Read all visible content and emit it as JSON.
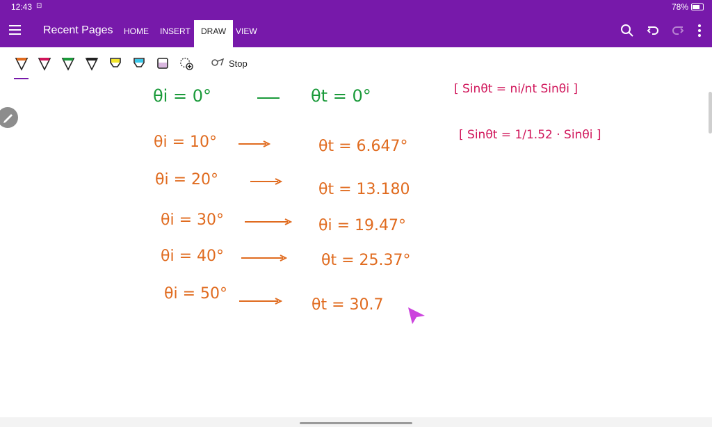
{
  "status": {
    "time": "12:43",
    "battery": "78%"
  },
  "app": {
    "title": "Recent Pages",
    "tabs": [
      {
        "label": "HOME",
        "active": false
      },
      {
        "label": "INSERT",
        "active": false
      },
      {
        "label": "DRAW",
        "active": true
      },
      {
        "label": "VIEW",
        "active": false
      }
    ],
    "accent": "#7719aa"
  },
  "toolbar": {
    "pens": [
      {
        "name": "pen-orange",
        "color": "#e06b1f"
      },
      {
        "name": "pen-magenta",
        "color": "#d0155a"
      },
      {
        "name": "pen-green",
        "color": "#1a9a3a"
      },
      {
        "name": "pen-black",
        "color": "#222222"
      },
      {
        "name": "highlighter-yellow",
        "color": "#f3e52a"
      },
      {
        "name": "highlighter-cyan",
        "color": "#38c6e8"
      },
      {
        "name": "highlighter-lavender",
        "color": "#d9b7df"
      }
    ],
    "stop_label": "Stop"
  },
  "notes": {
    "green_line": {
      "left": "θi = 0°",
      "right": "θt = 0°"
    },
    "rows": [
      {
        "left": "θi = 10°",
        "right": "θt = 6.647°"
      },
      {
        "left": "θi = 20°",
        "right": "θt = 13.180"
      },
      {
        "left": "θi = 30°",
        "right": "θi = 19.47°"
      },
      {
        "left": "θi = 40°",
        "right": "θt = 25.37°"
      },
      {
        "left": "θi = 50°",
        "right": "θt = 30.7"
      }
    ],
    "formula1": "[ Sinθt = ni/nt Sinθi ]",
    "formula2": "[ Sinθt = 1/1.52 · Sinθi ]"
  }
}
